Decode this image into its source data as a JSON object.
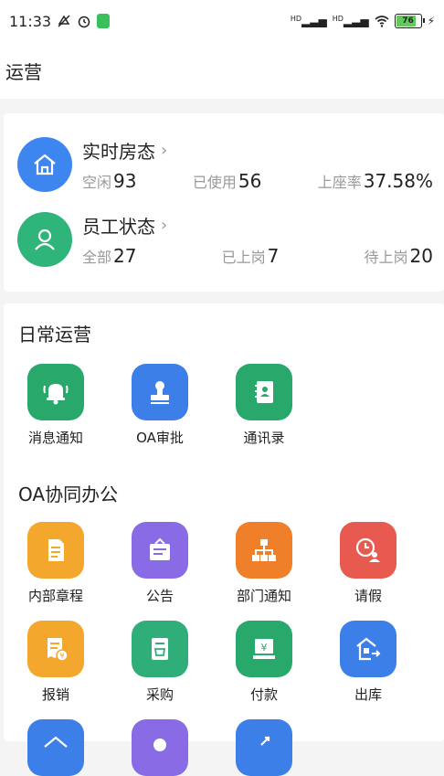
{
  "status_bar": {
    "time": "11:33",
    "signal1": "HD",
    "signal2": "HD",
    "battery": "76"
  },
  "header": {
    "title": "运营"
  },
  "stats": [
    {
      "title": "实时房态",
      "metrics": [
        {
          "label": "空闲",
          "value": "93"
        },
        {
          "label": "已使用",
          "value": "56"
        },
        {
          "label": "上座率",
          "value": "37.58%"
        }
      ],
      "color": "#3d86f0"
    },
    {
      "title": "员工状态",
      "metrics": [
        {
          "label": "全部",
          "value": "27"
        },
        {
          "label": "已上岗",
          "value": "7"
        },
        {
          "label": "待上岗",
          "value": "20"
        }
      ],
      "color": "#2fb47a"
    }
  ],
  "sections": [
    {
      "title": "日常运营",
      "apps": [
        {
          "label": "消息通知",
          "icon": "bell-icon",
          "color": "#29a86b"
        },
        {
          "label": "OA审批",
          "icon": "stamp-icon",
          "color": "#3d7fe8"
        },
        {
          "label": "通讯录",
          "icon": "contacts-icon",
          "color": "#29a86b"
        }
      ]
    },
    {
      "title": "OA协同办公",
      "apps": [
        {
          "label": "内部章程",
          "icon": "document-icon",
          "color": "#f3a72d"
        },
        {
          "label": "公告",
          "icon": "board-icon",
          "color": "#8a6be6"
        },
        {
          "label": "部门通知",
          "icon": "org-chart-icon",
          "color": "#f07f2a"
        },
        {
          "label": "请假",
          "icon": "leave-icon",
          "color": "#e85a4f"
        },
        {
          "label": "报销",
          "icon": "reimburse-icon",
          "color": "#f3a72d"
        },
        {
          "label": "采购",
          "icon": "purchase-icon",
          "color": "#2fae7a"
        },
        {
          "label": "付款",
          "icon": "payment-icon",
          "color": "#29a86b"
        },
        {
          "label": "出库",
          "icon": "warehouse-icon",
          "color": "#3d7fe8"
        }
      ]
    }
  ],
  "partial_row_colors": [
    "#3d7fe8",
    "#8a6be6",
    "#3d7fe8"
  ]
}
